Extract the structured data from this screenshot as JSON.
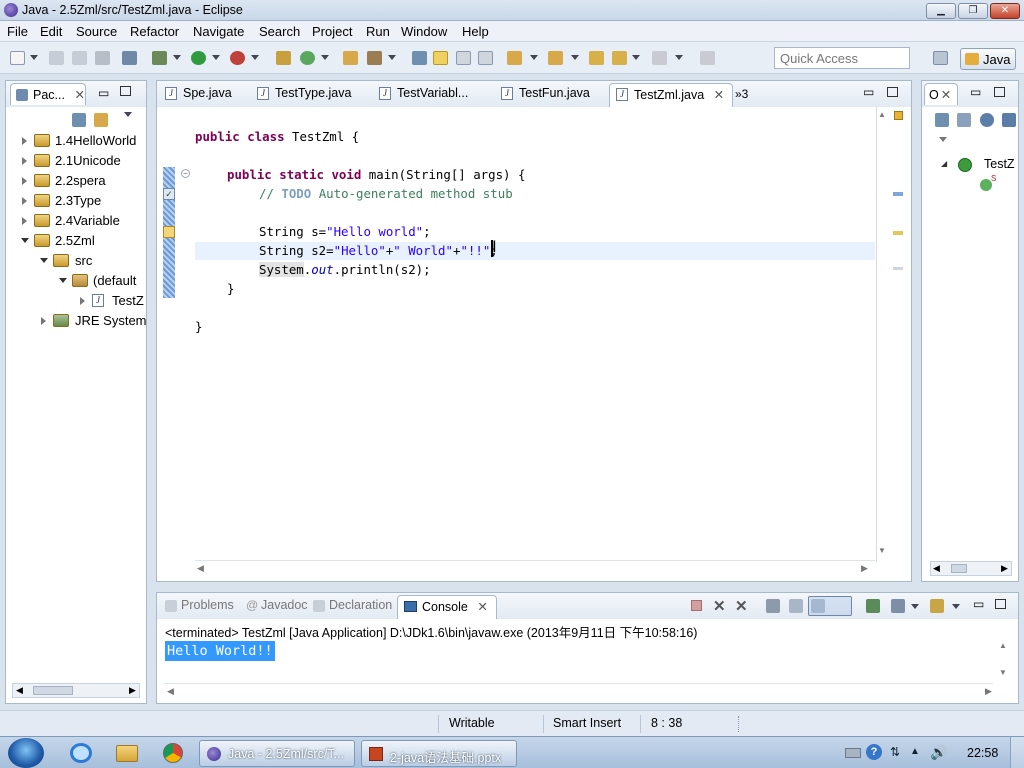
{
  "window": {
    "title": "Java - 2.5Zml/src/TestZml.java - Eclipse"
  },
  "menu": [
    "File",
    "Edit",
    "Source",
    "Refactor",
    "Navigate",
    "Search",
    "Project",
    "Run",
    "Window",
    "Help"
  ],
  "toolbar": {
    "quick_access_placeholder": "Quick Access",
    "perspective": "Java"
  },
  "package_explorer": {
    "tab_label": "Pac...",
    "items": [
      {
        "label": "1.4HelloWorld"
      },
      {
        "label": "2.1Unicode"
      },
      {
        "label": "2.2spera"
      },
      {
        "label": "2.3Type"
      },
      {
        "label": "2.4Variable"
      },
      {
        "label": "2.5Zml"
      },
      {
        "label": "src"
      },
      {
        "label": "(default"
      },
      {
        "label": "TestZ"
      },
      {
        "label": "JRE System"
      }
    ]
  },
  "editor": {
    "tabs": [
      {
        "label": "Spe.java"
      },
      {
        "label": "TestType.java"
      },
      {
        "label": "TestVariabl..."
      },
      {
        "label": "TestFun.java"
      },
      {
        "label": "TestZml.java",
        "active": true
      }
    ],
    "overflow_label": "»3",
    "code": {
      "l1_kw1": "public",
      "l1_kw2": "class",
      "l1_rest": " TestZml {",
      "l3_kw1": "public",
      "l3_kw2": "static",
      "l3_kw3": "void",
      "l3_rest": " main(String[] args) {",
      "l4_c1": "// ",
      "l4_todo": "TODO",
      "l4_c2": " Auto-generated method stub",
      "l6_a": "String s=",
      "l6_str": "\"Hello world\"",
      "l6_b": ";",
      "l7_a": "String s2=",
      "l7_s1": "\"Hello\"",
      "l7_p1": "+",
      "l7_s2": "\" World\"",
      "l7_p2": "+",
      "l7_s3": "\"!!\"",
      "l7_b": ";",
      "l8_a": "System",
      "l8_dot": ".",
      "l8_fld": "out",
      "l8_b": ".println(s2);",
      "l9": "}",
      "l11": "}"
    }
  },
  "outline": {
    "tab_label": "O",
    "item_label": "TestZ",
    "method_marker": "S"
  },
  "console": {
    "tabs": [
      {
        "label": "Problems"
      },
      {
        "label": "Javadoc"
      },
      {
        "label": "Declaration"
      },
      {
        "label": "Console",
        "active": true
      }
    ],
    "header": "<terminated> TestZml [Java Application] D:\\JDk1.6\\bin\\javaw.exe (2013年9月11日 下午10:58:16)",
    "output": "Hello World!!"
  },
  "statusbar": {
    "writable": "Writable",
    "insert_mode": "Smart Insert",
    "position": "8 : 38"
  },
  "taskbar": {
    "items": [
      {
        "label": "Java - 2.5Zml/src/T..."
      },
      {
        "label": "2-java语法基础.pptx"
      }
    ],
    "clock": "22:58"
  },
  "colors": {
    "keyword": "#7f0055",
    "string": "#2a00ff",
    "comment": "#3f7f5f",
    "selection": "#3399ff"
  }
}
